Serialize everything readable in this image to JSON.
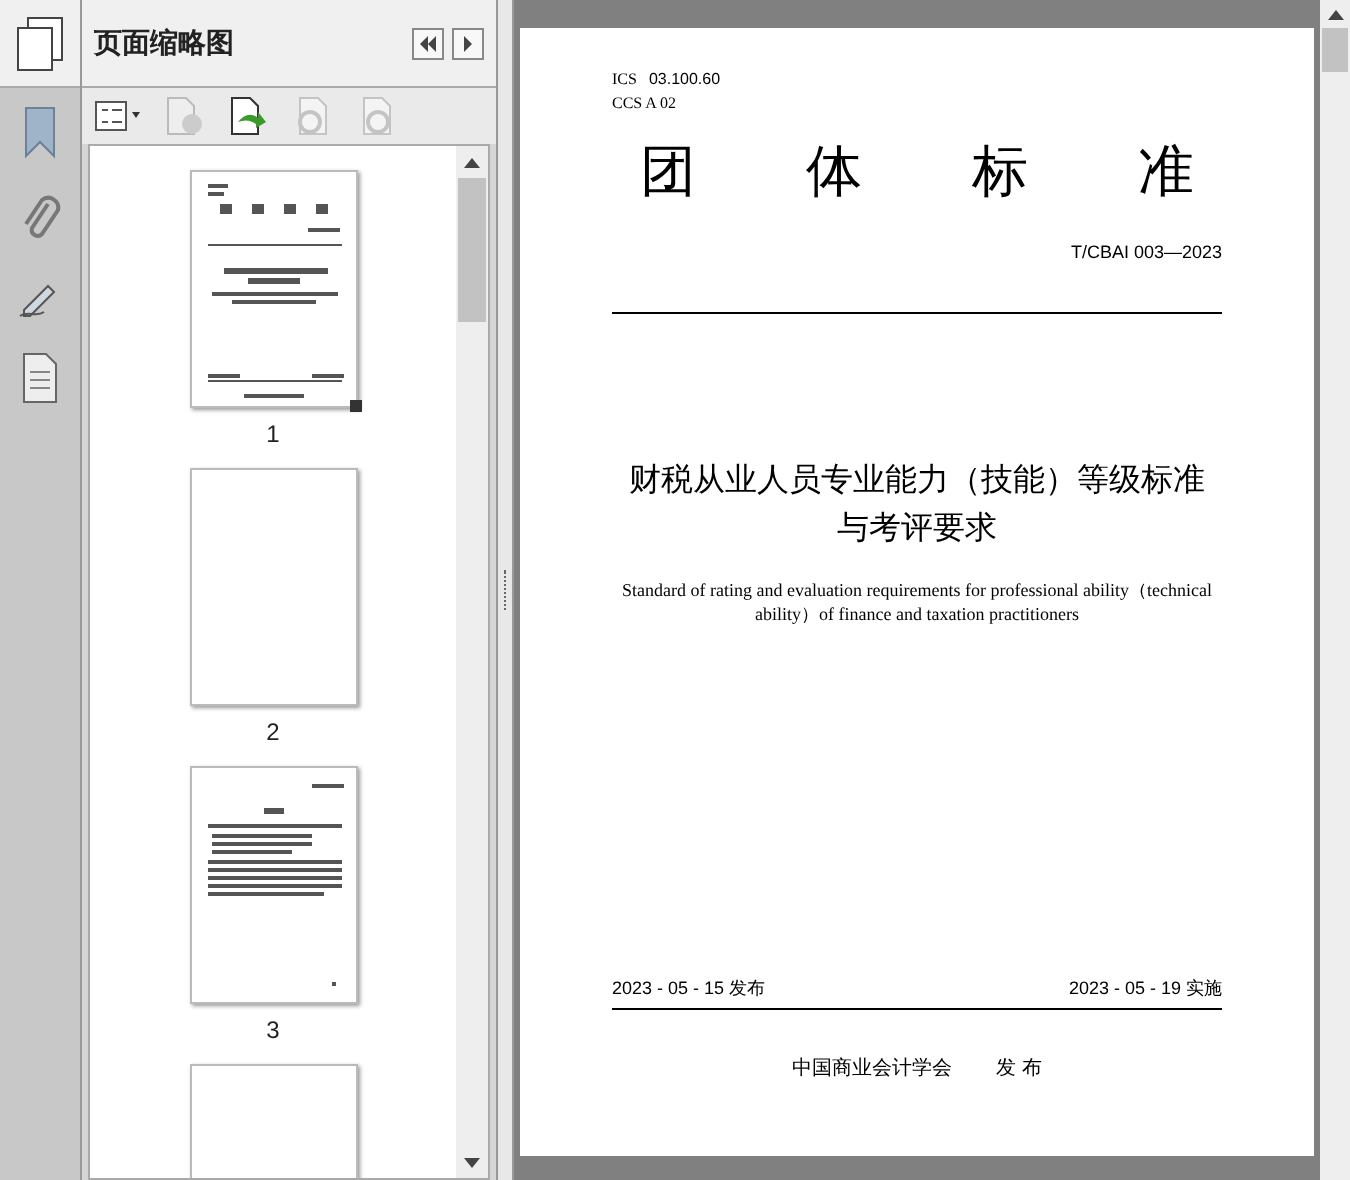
{
  "panel": {
    "title": "页面缩略图"
  },
  "thumbnails": [
    {
      "label": "1",
      "kind": "cover",
      "selected": true
    },
    {
      "label": "2",
      "kind": "blank",
      "selected": false
    },
    {
      "label": "3",
      "kind": "text",
      "selected": false
    },
    {
      "kind": "blank",
      "selected": false
    }
  ],
  "document": {
    "ics": "ICS",
    "ics_code": "03.100.60",
    "ccs": "CCS A 02",
    "heading": [
      "团",
      "体",
      "标",
      "准"
    ],
    "number": "T/CBAI 003—2023",
    "title_lines": [
      "财税从业人员专业能力（技能）等级标准",
      "与考评要求"
    ],
    "english_title": "Standard of rating and evaluation requirements for professional ability（technical ability）of finance and taxation practitioners",
    "issue_date": "2023 - 05 - 15 发布",
    "effective_date": "2023 - 05 - 19 实施",
    "publisher": "中国商业会计学会",
    "publish_word": "发 布"
  }
}
